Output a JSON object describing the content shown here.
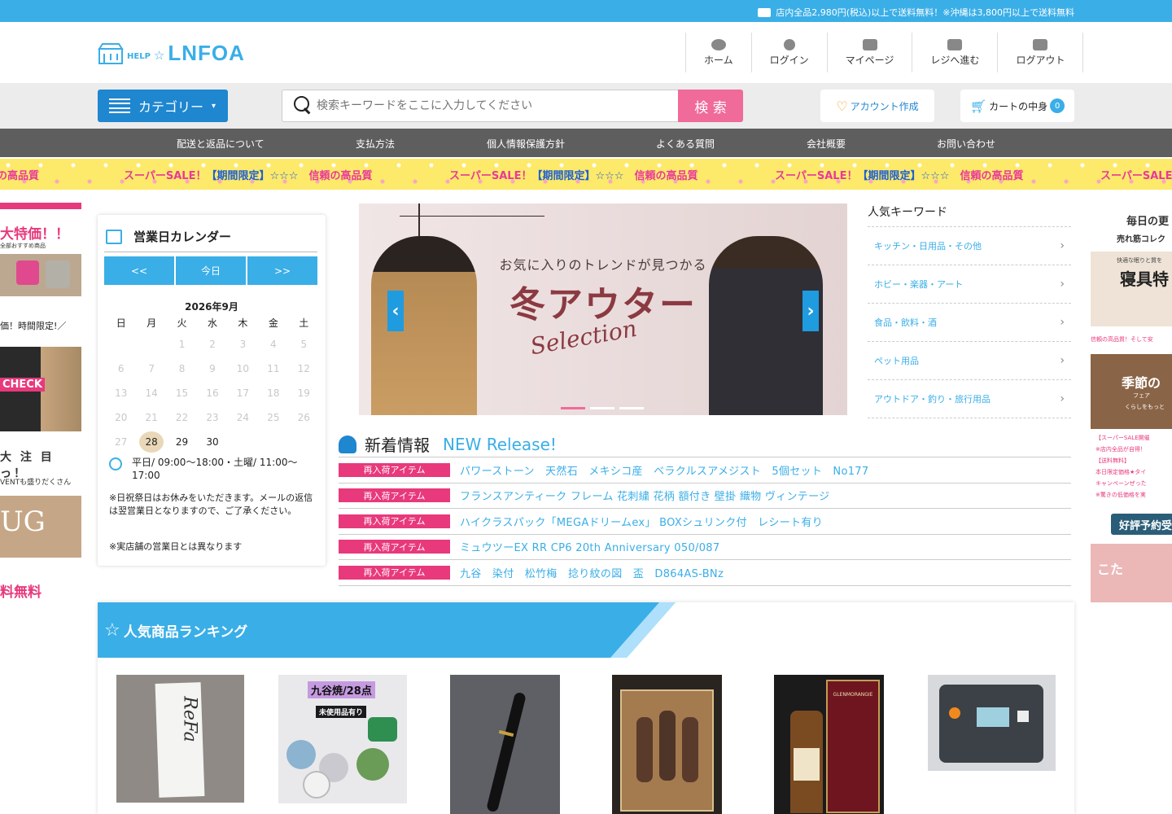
{
  "topbar": {
    "shipping_notice": "店内全品2,980円(税込)以上で送料無料！※沖縄は3,800円以上で送料無料"
  },
  "header": {
    "logo_help": "HELP",
    "logo_name": "LNFOA",
    "nav": [
      {
        "label": "ホーム",
        "icon": "home-icon"
      },
      {
        "label": "ログイン",
        "icon": "user-icon"
      },
      {
        "label": "マイページ",
        "icon": "id-card-icon"
      },
      {
        "label": "レジへ進む",
        "icon": "register-icon"
      },
      {
        "label": "ログアウト",
        "icon": "logout-icon"
      }
    ]
  },
  "search": {
    "category_label": "カテゴリー",
    "placeholder": "検索キーワードをここに入力してください",
    "button": "検 索",
    "account_label": "アカウント作成",
    "cart_label": "カートの中身",
    "cart_count": "0"
  },
  "menu": [
    "配送と返品について",
    "支払方法",
    "個人情報保護方針",
    "よくある質問",
    "会社概要",
    "お問い合わせ"
  ],
  "strip": {
    "a": "スーパーSALE！",
    "b": "【期間限定】☆☆☆",
    "c": "信頼の高品質"
  },
  "left_ad": {
    "t1": "大特価！！",
    "t2": "全部おすすめ商品",
    "t3": "価！時間限定!／",
    "t4": "CHECK",
    "t5": "大 注 目っ！",
    "t6": "VENTも盛りだくさん",
    "t7": "UG",
    "t8": "料無料"
  },
  "calendar": {
    "title": "営業日カレンダー",
    "prev": "<<",
    "today": "今日",
    "next": ">>",
    "month": "2026年9月",
    "weekdays": [
      "日",
      "月",
      "火",
      "水",
      "木",
      "金",
      "土"
    ],
    "days": [
      "",
      "",
      "1",
      "2",
      "3",
      "4",
      "5",
      "6",
      "7",
      "8",
      "9",
      "10",
      "11",
      "12",
      "13",
      "14",
      "15",
      "16",
      "17",
      "18",
      "19",
      "20",
      "21",
      "22",
      "23",
      "24",
      "25",
      "26",
      "27",
      "28",
      "29",
      "30",
      "",
      "",
      ""
    ],
    "active_days": [
      "28",
      "29",
      "30"
    ],
    "today_day": "28",
    "hours": "平日/ 09:00～18:00・土曜/ 11:00～17:00",
    "note1": "※日祝祭日はお休みをいただきます。メールの返信は翌営業日となりますので、ご了承ください。",
    "note2": "※実店舗の営業日とは異なります"
  },
  "hero": {
    "lead": "お気に入りのトレンドが見つかる",
    "title": "冬アウター",
    "subtitle": "Selection",
    "prev": "‹",
    "next": "›"
  },
  "keywords": {
    "title": "人気キーワード",
    "items": [
      "キッチン・日用品・その他",
      "ホビー・楽器・アート",
      "食品・飲料・酒",
      "ペット用品",
      "アウトドア・釣り・旅行用品"
    ]
  },
  "right_ad": {
    "t1": "毎日の更",
    "t2": "売れ筋コレク",
    "t3": "寝具特",
    "t4": "快適な眠りと質を",
    "t5": "信頼の高品質！そして安",
    "t6": "季節の",
    "t7": "フェア",
    "t8": "くらしをもっと",
    "t9": "【スーパーSALE開催",
    "t10": "※店内全品が自得！",
    "t11": "【送料無料】",
    "t12": "本日限定価格★タイ",
    "t13": "キャンペーンぜった",
    "t14": "※驚きの低価格を実",
    "t15": "好評予約受",
    "t16": "こた"
  },
  "news": {
    "title_jp": "新着情報",
    "title_en": "NEW Release!",
    "items": [
      {
        "tag": "再入荷アイテム",
        "text": "パワーストーン　天然石　メキシコ産　ベラクルスアメジスト　5個セット　No177"
      },
      {
        "tag": "再入荷アイテム",
        "text": "フランスアンティーク フレーム 花刺繍 花柄 額付き 壁掛 織物 ヴィンテージ"
      },
      {
        "tag": "再入荷アイテム",
        "text": "ハイクラスパック「MEGAドリームex」 BOXシュリンク付　レシート有り"
      },
      {
        "tag": "再入荷アイテム",
        "text": "ミュウツーEX RR CP6 20th Anniversary 050/087"
      },
      {
        "tag": "再入荷アイテム",
        "text": "九谷　染付　松竹梅　捻り紋の図　盃　D864AS-BNz"
      }
    ]
  },
  "ranking": {
    "title": "人気商品ランキング",
    "p2_label": "九谷焼/28点",
    "p2_sub": "未使用品有り",
    "p1_brand": "ReFa",
    "p5_brand": "GLENMORANGIE"
  },
  "colors": {
    "accent": "#3aaee7",
    "nav_blue": "#1f86d0",
    "pink": "#f06a9a",
    "tag_pink": "#e8397c",
    "menu_gray": "#5e5e5e"
  }
}
